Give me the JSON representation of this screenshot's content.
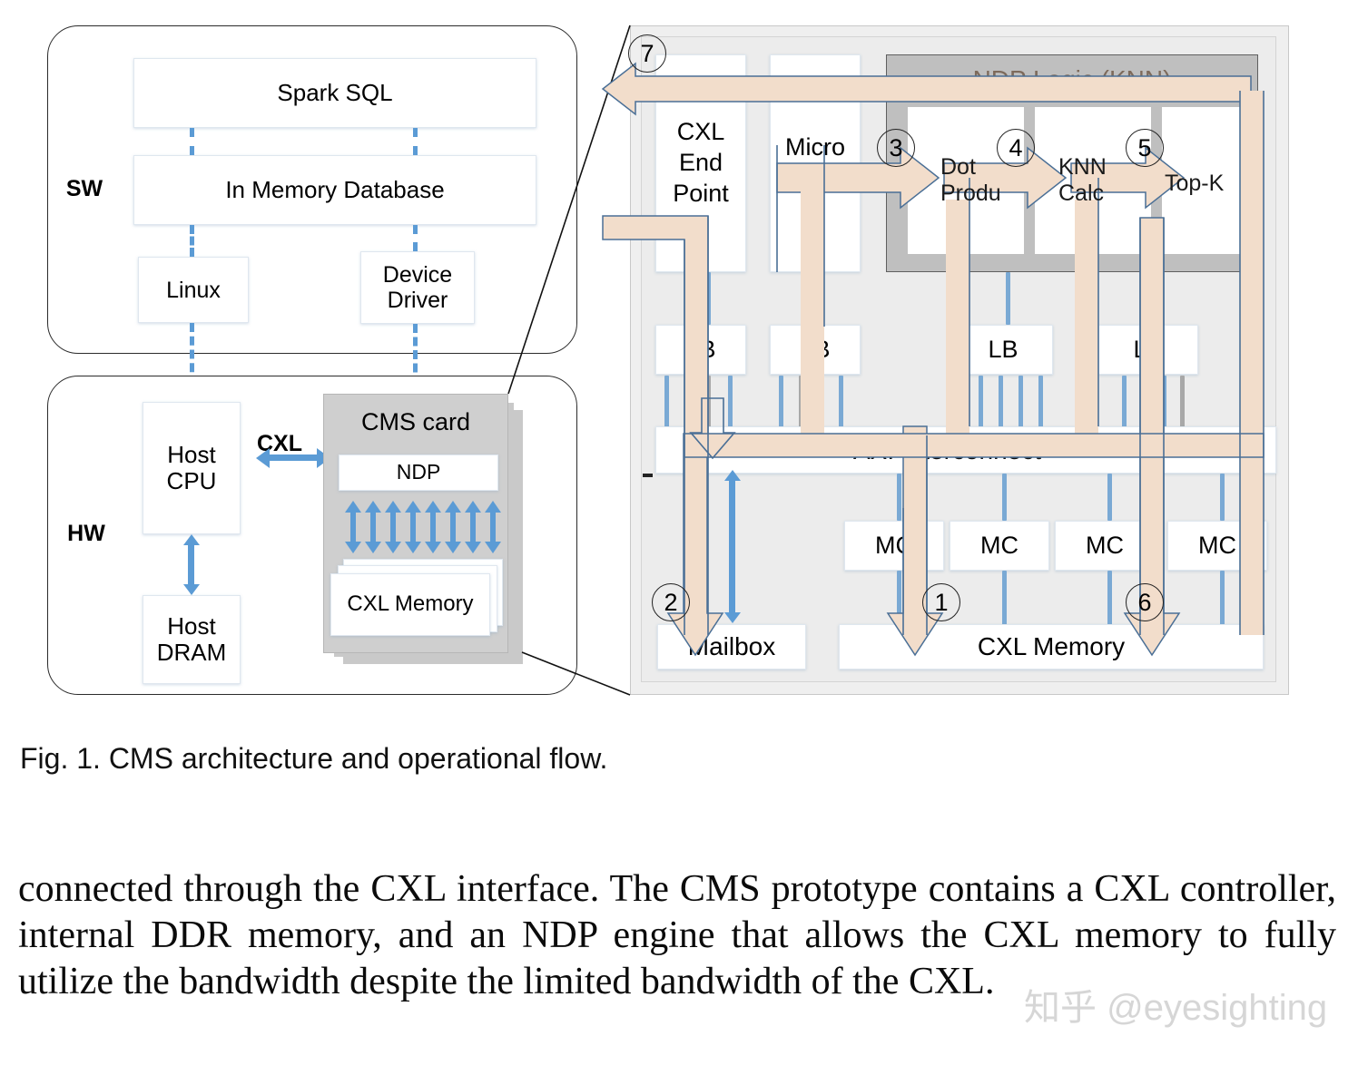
{
  "figure": {
    "caption": "Fig. 1. CMS architecture and operational flow.",
    "sw_zone_label": "SW",
    "hw_zone_label": "HW",
    "sw_blocks": {
      "spark_sql": "Spark SQL",
      "in_memory_database": "In Memory Database",
      "linux": "Linux",
      "device_driver": "Device Driver"
    },
    "hw_blocks": {
      "host_cpu": "Host CPU",
      "host_dram": "Host DRAM",
      "cxl_link_label": "CXL",
      "cms_card_title": "CMS card",
      "ndp": "NDP",
      "cxl_memory": "CXL Memory"
    },
    "right_panel": {
      "cxl_end_point": "CXL End Point",
      "micro_blaze": "Micro Blaze",
      "ndp_logic_title": "NDP Logic (KNN)",
      "dot_product": "Dot Produ",
      "knn_calc": "KNN Calc",
      "top_k": "Top-K",
      "lb_label": "LB",
      "axi_interconnect": "AXI Interconnect",
      "mc_label": "MC",
      "mailbox": "Mailbox",
      "cxl_memory": "CXL Memory",
      "lb_boxes": [
        "LB",
        "LB",
        "LB",
        "LB"
      ],
      "mc_boxes": [
        "MC",
        "MC",
        "MC",
        "MC"
      ],
      "step_numbers": [
        "1",
        "2",
        "3",
        "4",
        "5",
        "6",
        "7"
      ]
    }
  },
  "body_text": "connected through the CXL interface. The CMS prototype contains a CXL controller, internal DDR memory, and an NDP engine that allows the CXL memory to fully utilize the bandwidth despite the limited bandwidth of the CXL.",
  "watermark": "知乎 @eyesighting",
  "colors": {
    "accent_blue": "#5b9bd5",
    "tan_ribbon": "#f2ddcb",
    "panel_grey": "#efefef",
    "ndp_zone_grey": "#bfbfbf",
    "card_grey": "#cfcfcf"
  }
}
